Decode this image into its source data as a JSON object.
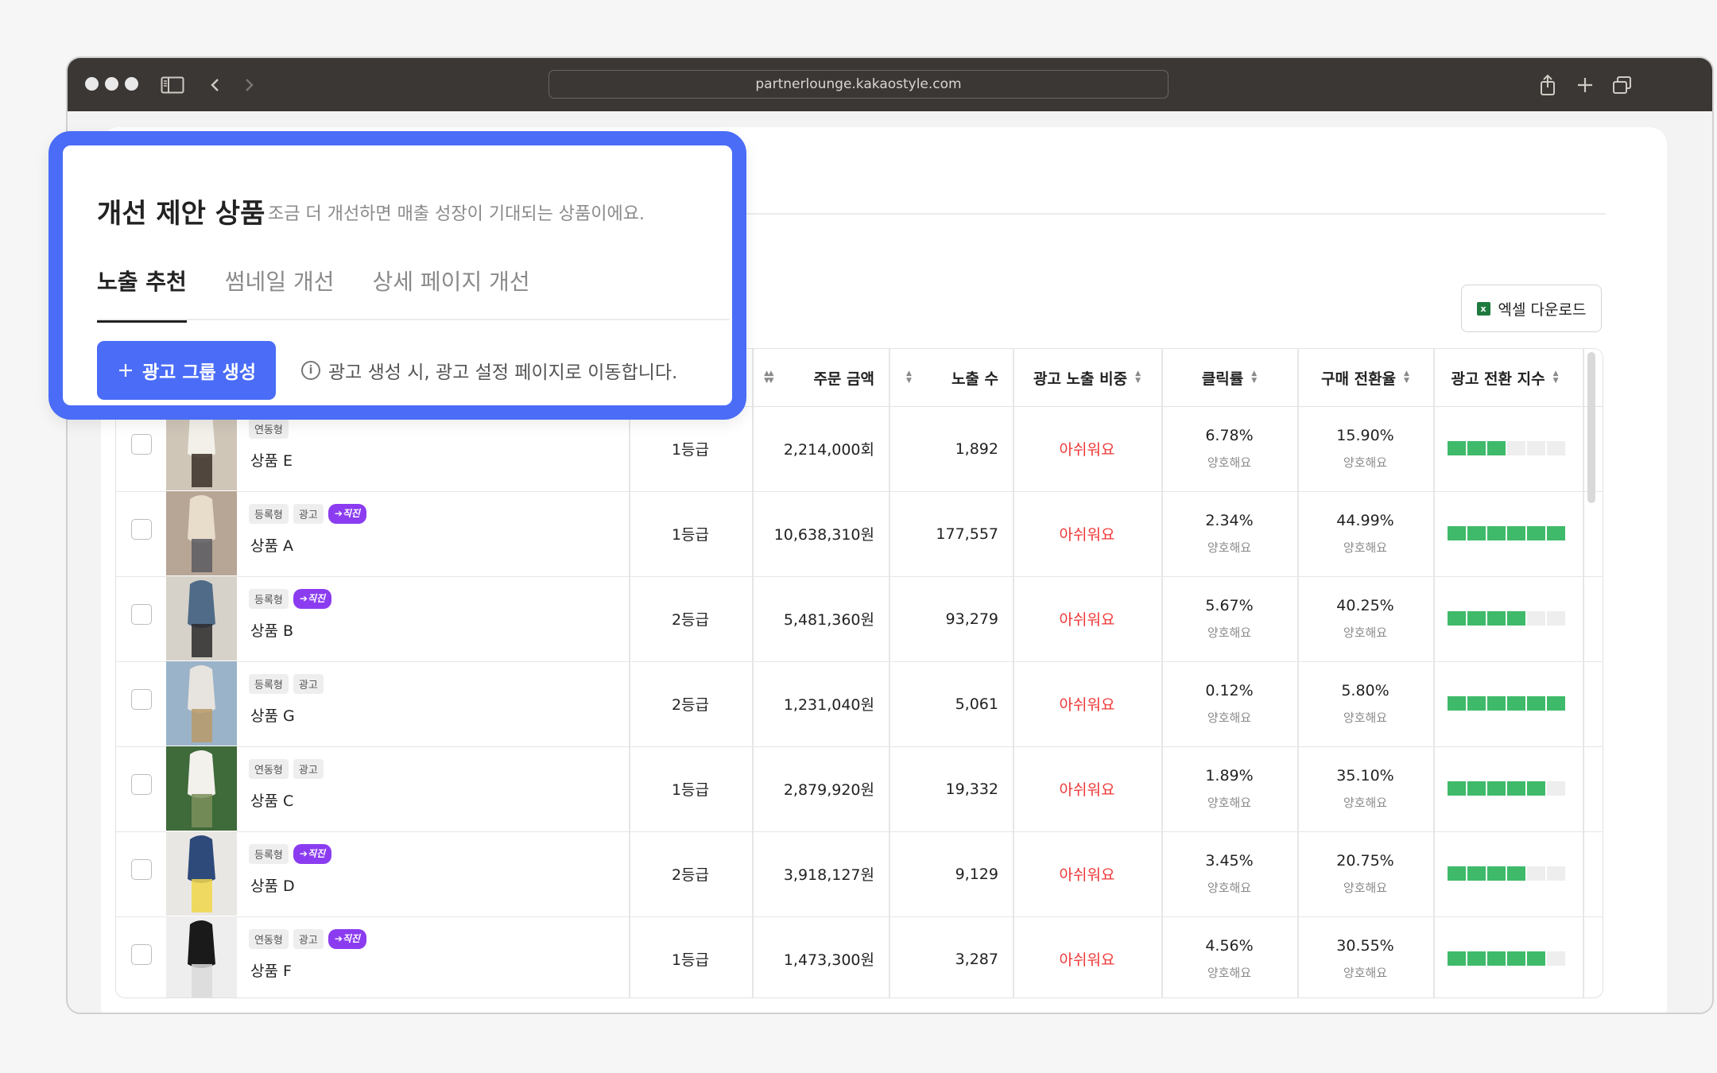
{
  "browser": {
    "url": "partnerlounge.kakaostyle.com"
  },
  "popup": {
    "title": "개선 제안 상품",
    "subtitle": "조금 더 개선하면 매출 성장이 기대되는 상품이에요.",
    "tabs": [
      "노출 추천",
      "썸네일 개선",
      "상세 페이지 개선"
    ],
    "active_tab": "노출 추천",
    "ad_button": "광고 그룹 생성",
    "info_text": "광고 생성 시, 광고 설정 페이지로 이동합니다."
  },
  "toolbar": {
    "excel_button": "엑셀 다운로드"
  },
  "table": {
    "headers": {
      "order_amount": "주문 금액",
      "impressions": "노출 수",
      "ad_share": "광고 노출 비중",
      "ctr": "클릭률",
      "cvr": "구매 전환율",
      "ad_index": "광고 전환 지수"
    },
    "rows": [
      {
        "tags": [
          "연동형"
        ],
        "badge": "",
        "name": "상품 E",
        "grade": "1등급",
        "amount": "2,214,000회",
        "impressions": "1,892",
        "ad_share": "아쉬워요",
        "ctr": "6.78%",
        "ctr_note": "양호해요",
        "cvr": "15.90%",
        "cvr_note": "양호해요",
        "index": 3,
        "thumb_colors": [
          "#cfc6b8",
          "#f3f0ea",
          "#3a2f27"
        ]
      },
      {
        "tags": [
          "등록형",
          "광고"
        ],
        "badge": "직진",
        "name": "상품 A",
        "grade": "1등급",
        "amount": "10,638,310원",
        "impressions": "177,557",
        "ad_share": "아쉬워요",
        "ctr": "2.34%",
        "ctr_note": "양호해요",
        "cvr": "44.99%",
        "cvr_note": "양호해요",
        "index": 6,
        "thumb_colors": [
          "#b7a595",
          "#e8dccb",
          "#5a5a60"
        ]
      },
      {
        "tags": [
          "등록형"
        ],
        "badge": "직진",
        "name": "상품 B",
        "grade": "2등급",
        "amount": "5,481,360원",
        "impressions": "93,279",
        "ad_share": "아쉬워요",
        "ctr": "5.67%",
        "ctr_note": "양호해요",
        "cvr": "40.25%",
        "cvr_note": "양호해요",
        "index": 4,
        "thumb_colors": [
          "#d6d2c9",
          "#4f6b87",
          "#2a2a2a"
        ]
      },
      {
        "tags": [
          "등록형",
          "광고"
        ],
        "badge": "",
        "name": "상품 G",
        "grade": "2등급",
        "amount": "1,231,040원",
        "impressions": "5,061",
        "ad_share": "아쉬워요",
        "ctr": "0.12%",
        "ctr_note": "양호해요",
        "cvr": "5.80%",
        "cvr_note": "양호해요",
        "index": 6,
        "thumb_colors": [
          "#9ab3c9",
          "#e7e4df",
          "#b99a6a"
        ]
      },
      {
        "tags": [
          "연동형",
          "광고"
        ],
        "badge": "",
        "name": "상품 C",
        "grade": "1등급",
        "amount": "2,879,920원",
        "impressions": "19,332",
        "ad_share": "아쉬워요",
        "ctr": "1.89%",
        "ctr_note": "양호해요",
        "cvr": "35.10%",
        "cvr_note": "양호해요",
        "index": 5,
        "thumb_colors": [
          "#3f6a3a",
          "#f2f1ec",
          "#7b8f5a"
        ]
      },
      {
        "tags": [
          "등록형"
        ],
        "badge": "직진",
        "name": "상품 D",
        "grade": "2등급",
        "amount": "3,918,127원",
        "impressions": "9,129",
        "ad_share": "아쉬워요",
        "ctr": "3.45%",
        "ctr_note": "양호해요",
        "cvr": "20.75%",
        "cvr_note": "양호해요",
        "index": 4,
        "thumb_colors": [
          "#e9e7e3",
          "#2e4a7a",
          "#f1d64a"
        ]
      },
      {
        "tags": [
          "연동형",
          "광고"
        ],
        "badge": "직진",
        "name": "상품 F",
        "grade": "1등급",
        "amount": "1,473,300원",
        "impressions": "3,287",
        "ad_share": "아쉬워요",
        "ctr": "4.56%",
        "ctr_note": "양호해요",
        "cvr": "30.55%",
        "cvr_note": "양호해요",
        "index": 5,
        "thumb_colors": [
          "#eeeeee",
          "#1a1a1a",
          "#d9d9d9"
        ]
      }
    ]
  },
  "colors": {
    "accent": "#4a6cf7",
    "warn": "#ef3838",
    "good": "#3fba6a",
    "badge": "#8b3cf0"
  }
}
